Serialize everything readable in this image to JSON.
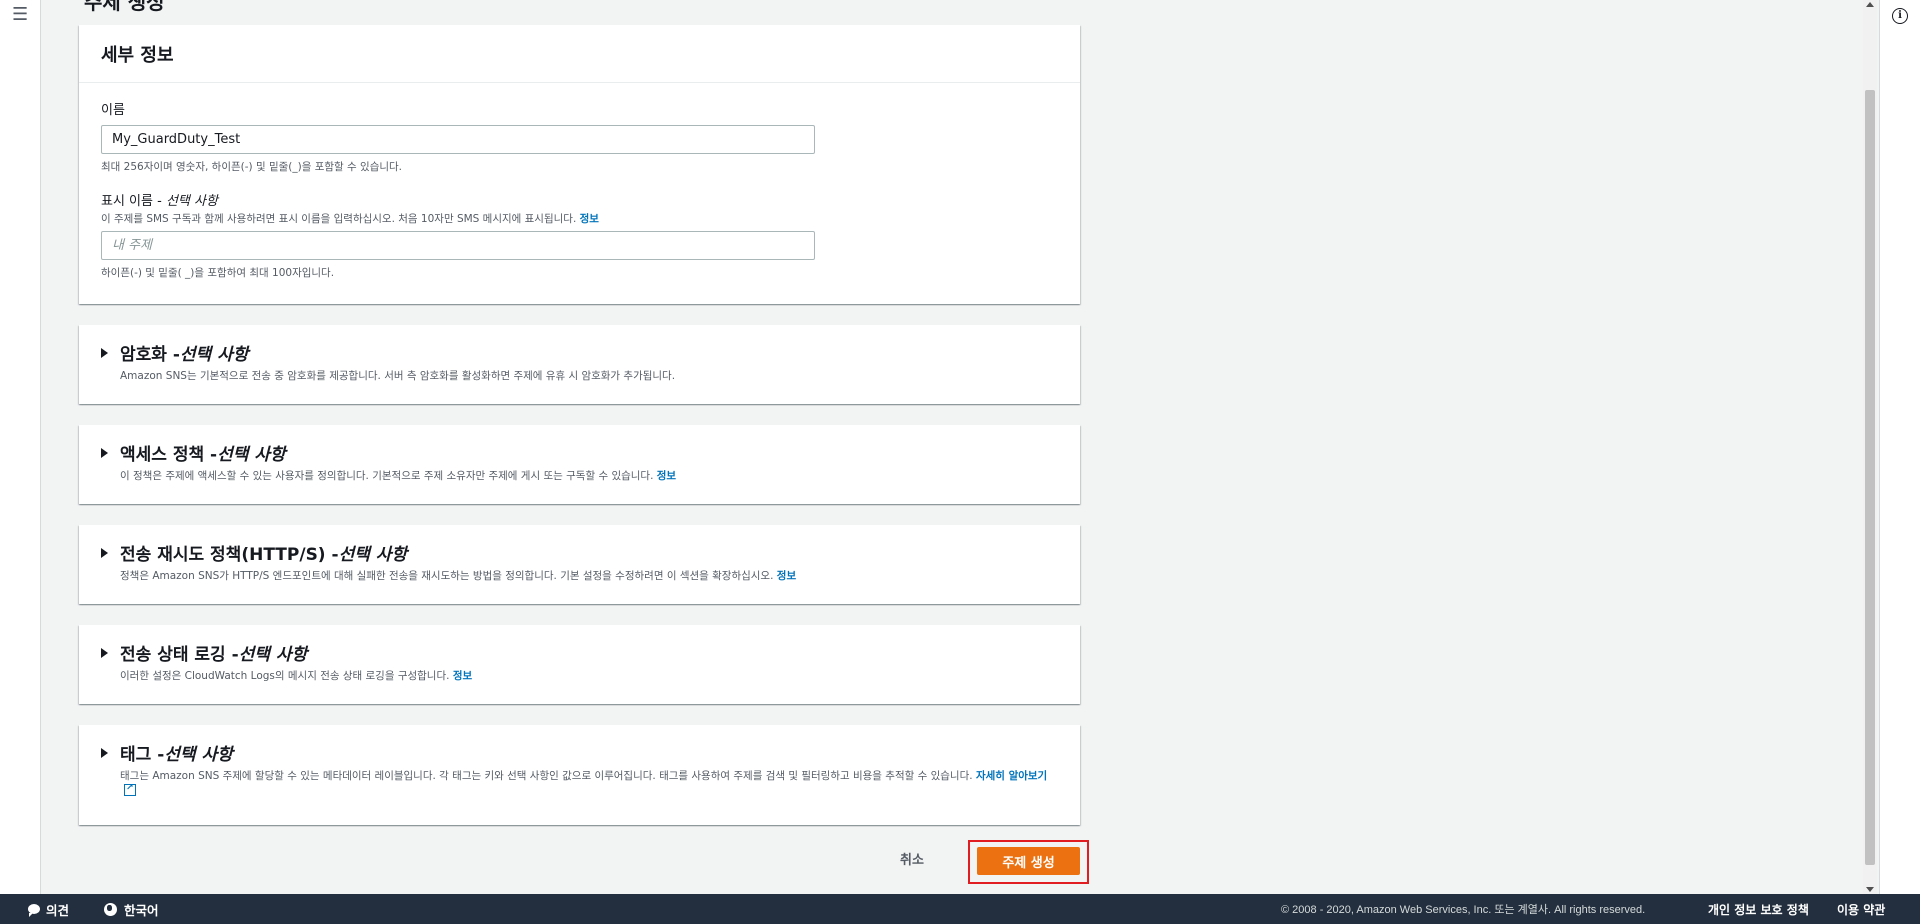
{
  "page": {
    "title_peek": "주제 생성"
  },
  "details": {
    "header": "세부 정보",
    "name_label": "이름",
    "name_value": "My_GuardDuty_Test",
    "name_hint": "최대 256자이며 영숫자, 하이픈(-) 및 밑줄(_)을 포함할 수 있습니다.",
    "display_label": "표시 이름 - ",
    "display_optional": "선택 사항",
    "display_desc": "이 주제를 SMS 구독과 함께 사용하려면 표시 이름을 입력하십시오. 처음 10자만 SMS 메시지에 표시됩니다. ",
    "display_placeholder": "내 주제",
    "display_hint": "하이픈(-) 및 밑줄( _)을 포함하여 최대 100자입니다."
  },
  "info_link": "정보",
  "sections": {
    "encryption": {
      "title": "암호화 - ",
      "optional": "선택 사항",
      "desc": "Amazon SNS는 기본적으로 전송 중 암호화를 제공합니다. 서버 측 암호화를 활성화하면 주제에 유휴 시 암호화가 추가됩니다."
    },
    "access": {
      "title": "액세스 정책 - ",
      "optional": "선택 사항",
      "desc": "이 정책은 주제에 액세스할 수 있는 사용자를 정의합니다. 기본적으로 주제 소유자만 주제에 게시 또는 구독할 수 있습니다. "
    },
    "retry": {
      "title": "전송 재시도 정책(HTTP/S) - ",
      "optional": "선택 사항",
      "desc": "정책은 Amazon SNS가 HTTP/S 엔드포인트에 대해 실패한 전송을 재시도하는 방법을 정의합니다. 기본 설정을 수정하려면 이 섹션을 확장하십시오. "
    },
    "logging": {
      "title": "전송 상태 로깅 - ",
      "optional": "선택 사항",
      "desc": "이러한 설정은 CloudWatch Logs의 메시지 전송 상태 로깅을 구성합니다. "
    },
    "tags": {
      "title": "태그 - ",
      "optional": "선택 사항",
      "desc": "태그는 Amazon SNS 주제에 할당할 수 있는 메타데이터 레이블입니다. 각 태그는 키와 선택 사항인 값으로 이루어집니다. 태그를 사용하여 주제를 검색 및 필터링하고 비용을 추적할 수 있습니다. ",
      "learn_more": "자세히 알아보기"
    }
  },
  "actions": {
    "cancel": "취소",
    "create": "주제 생성"
  },
  "footer": {
    "feedback": "의견",
    "language": "한국어",
    "copyright": "© 2008 - 2020, Amazon Web Services, Inc. 또는 계열사. All rights reserved.",
    "privacy": "개인 정보 보호 정책",
    "terms": "이용 약관"
  },
  "colors": {
    "primary": "#ec7211",
    "link": "#0073bb",
    "footer_bg": "#232f3e",
    "highlight": "#e11d21"
  }
}
